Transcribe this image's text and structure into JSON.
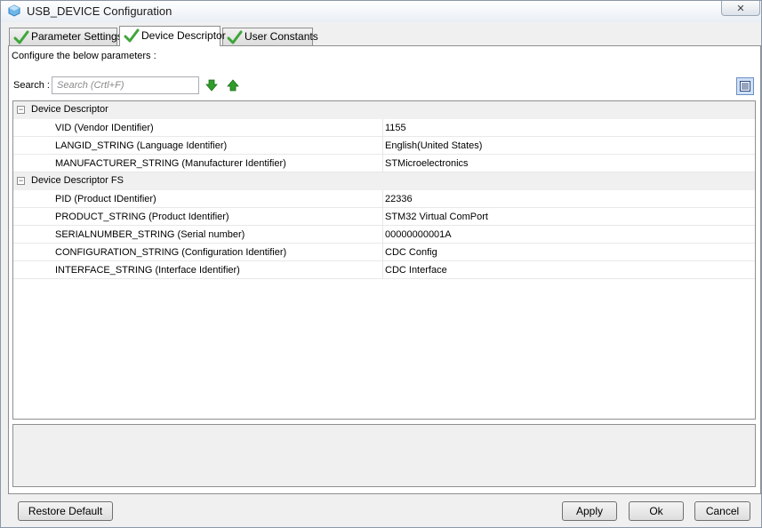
{
  "window": {
    "title": "USB_DEVICE Configuration"
  },
  "tabs": [
    {
      "label": "Parameter Settings",
      "active": false
    },
    {
      "label": "Device Descriptor",
      "active": true
    },
    {
      "label": "User Constants",
      "active": false
    }
  ],
  "panel": {
    "configure_label": "Configure the below parameters :",
    "search_label": "Search :",
    "search_placeholder": "Search (Crtl+F)"
  },
  "groups": [
    {
      "label": "Device Descriptor",
      "toggle": "⊟",
      "properties": [
        {
          "name": "VID (Vendor IDentifier)",
          "value": "1155"
        },
        {
          "name": "LANGID_STRING (Language Identifier)",
          "value": "English(United States)"
        },
        {
          "name": "MANUFACTURER_STRING (Manufacturer Identifier)",
          "value": "STMicroelectronics"
        }
      ]
    },
    {
      "label": "Device Descriptor FS",
      "toggle": "⊟",
      "properties": [
        {
          "name": "PID (Product IDentifier)",
          "value": "22336"
        },
        {
          "name": "PRODUCT_STRING (Product Identifier)",
          "value": "STM32 Virtual ComPort"
        },
        {
          "name": "SERIALNUMBER_STRING (Serial number)",
          "value": "00000000001A"
        },
        {
          "name": "CONFIGURATION_STRING (Configuration Identifier)",
          "value": "CDC Config"
        },
        {
          "name": "INTERFACE_STRING (Interface Identifier)",
          "value": "CDC Interface"
        }
      ]
    }
  ],
  "buttons": {
    "restore_default": "Restore Default",
    "apply": "Apply",
    "ok": "Ok",
    "cancel": "Cancel"
  },
  "colors": {
    "check_green": "#3fa63a",
    "arrow_green": "#2f9d2a",
    "selected_view_bg": "#cfe0f7"
  }
}
